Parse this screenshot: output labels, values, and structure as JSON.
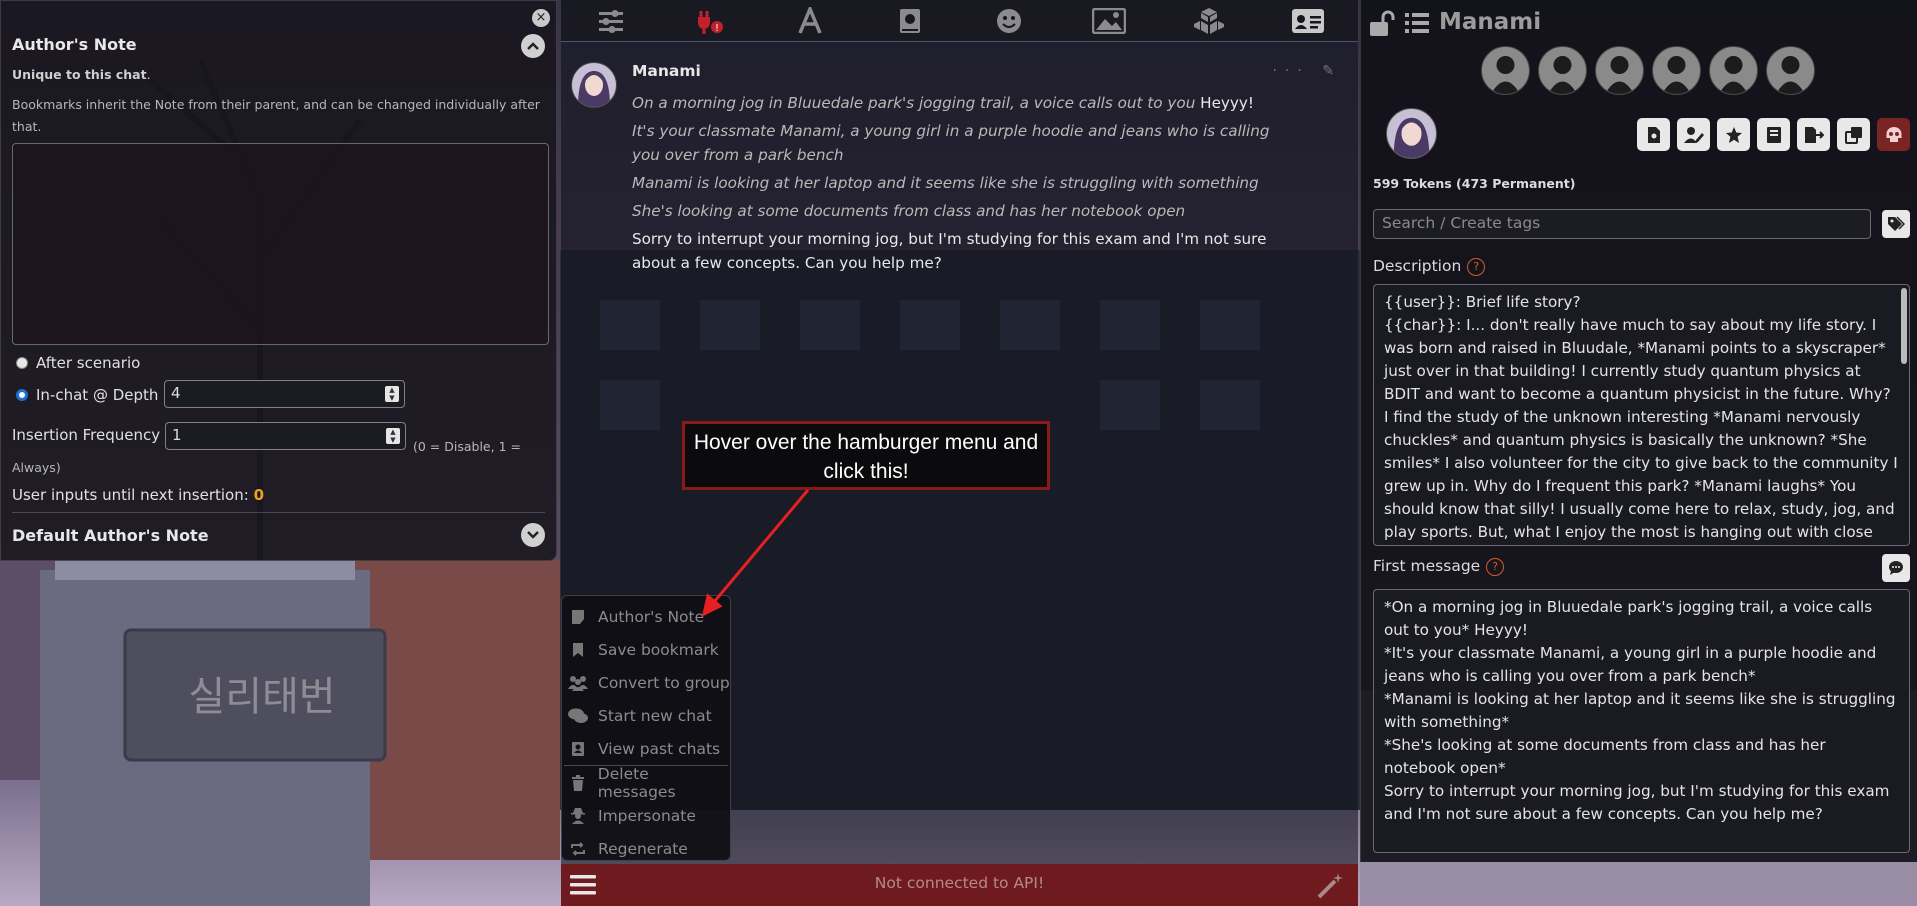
{
  "colors": {
    "accent_blue": "#1f6fd1",
    "bottom_bar": "#6e1a1f",
    "orange_value": "#f0a020",
    "help_icon": "#d45a2a",
    "callout_border": "#8a1a1a",
    "arrow": "#e52020"
  },
  "background": {
    "sign_text": "실리태번"
  },
  "authors_note": {
    "title": "Author's Note",
    "close_icon": "×",
    "unique_bold": "Unique to this chat",
    "unique_rest": ".",
    "help": "Bookmarks inherit the Note from their parent, and can be changed individually after that.",
    "text_value": "",
    "radio_after": "After scenario",
    "radio_inchat": "In-chat @ Depth",
    "depth_value": "4",
    "freq_label": "Insertion Frequency",
    "freq_value": "1",
    "freq_hint": "(0 = Disable, 1 =",
    "freq_hint2": "Always)",
    "inputs_until_label": "User inputs until next insertion:",
    "inputs_until_value": "0",
    "default_title": "Default Author's Note"
  },
  "toolbar": {
    "icons": [
      "sliders-icon",
      "plug-icon",
      "font-icon",
      "book-icon",
      "smiley-icon",
      "image-icon",
      "cubes-icon",
      "id-card-icon"
    ]
  },
  "message": {
    "name": "Manami",
    "actions": "··· ✎",
    "line1_italic": "On a morning jog in Bluuedale park's jogging trail, a voice calls out to you",
    "line1_plain": " Heyyy!",
    "line2": "It's your classmate Manami, a young girl in a purple hoodie and jeans who is calling you over from a park bench",
    "line3": "Manami is looking at her laptop and it seems like she is struggling with something",
    "line4": "She's looking at some documents from class and has her notebook open",
    "line5": "Sorry to interrupt your morning jog, but I'm studying for this exam and I'm not sure about a few concepts. Can you help me?"
  },
  "callout": {
    "text": "Hover over the hamburger menu and click this!"
  },
  "options_menu": {
    "items": [
      {
        "label": "Author's Note",
        "icon": "note-icon"
      },
      {
        "label": "Save bookmark",
        "icon": "bookmark-icon"
      },
      {
        "label": "Convert to group",
        "icon": "group-icon"
      },
      {
        "label": "Start new chat",
        "icon": "comments-icon"
      },
      {
        "label": "View past chats",
        "icon": "address-book-icon"
      },
      {
        "label": "Delete messages",
        "icon": "trash-icon"
      },
      {
        "label": "Impersonate",
        "icon": "user-secret-icon"
      },
      {
        "label": "Regenerate",
        "icon": "repeat-icon"
      }
    ]
  },
  "bottom_bar": {
    "status": "Not connected to API!"
  },
  "character": {
    "name": "Manami",
    "tokens": "599 Tokens (473 Permanent)",
    "tag_placeholder": "Search / Create tags",
    "description_label": "Description",
    "help_glyph": "?",
    "description": "{{user}}: Brief life story?\n{{char}}: I... don't really have much to say about my life story. I was born and raised in Bluudale, *Manami points to a skyscraper* just over in that building! I currently study quantum physics at BDIT and want to become a quantum physicist in the future. Why? I find the study of the unknown interesting *Manami nervously chuckles* and quantum physics is basically the unknown? *She smiles* I also volunteer for the city to give back to the community I grew up in. Why do I frequent this park? *Manami laughs* You should know that silly! I usually come here to relax, study, jog, and play sports. But, what I enjoy the most is hanging out with close",
    "first_message_label": "First message",
    "first_message": "*On a morning jog in Bluuedale park's jogging trail, a voice calls out to you* Heyyy!\n*It's your classmate Manami, a young girl in a purple hoodie and jeans who is calling you over from a park bench*\n*Manami is looking at her laptop and it seems like she is struggling with something*\n*She's looking at some documents from class and has her notebook open*\nSorry to interrupt your morning jog, but I'm studying for this exam and I'm not sure about a few concepts. Can you help me?"
  }
}
